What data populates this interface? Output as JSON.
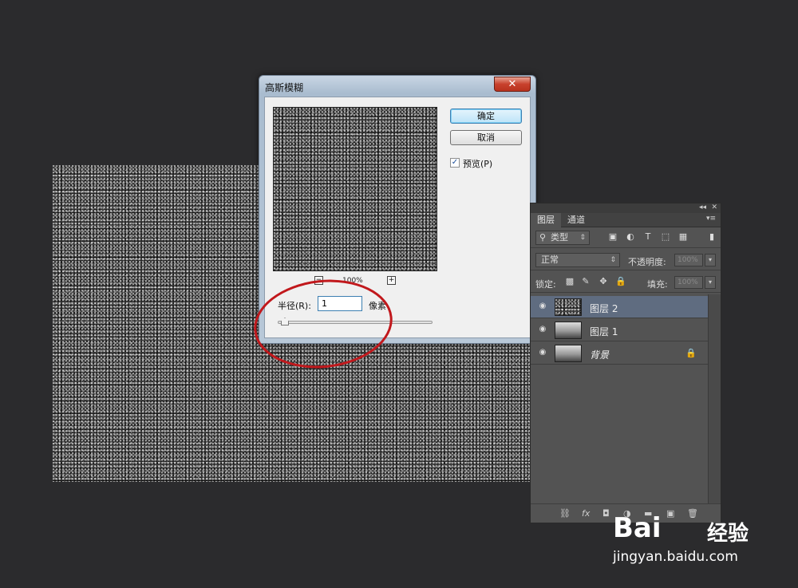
{
  "dialog": {
    "title": "高斯模糊",
    "close_label": "✕",
    "ok_label": "确定",
    "cancel_label": "取消",
    "preview_label": "预览(P)",
    "preview_checked": true,
    "zoom_out_label": "−",
    "zoom_in_label": "+",
    "zoom_level": "100%",
    "radius_label": "半径(R):",
    "radius_value": "1",
    "unit_label": "像素"
  },
  "layers_panel": {
    "tabs": [
      "图层",
      "通道"
    ],
    "filter_label": "类型",
    "blend_mode": "正常",
    "opacity_label": "不透明度:",
    "opacity_value": "100%",
    "lock_label": "锁定:",
    "fill_label": "填充:",
    "fill_value": "100%",
    "layers": [
      {
        "name": "图层 2",
        "selected": true
      },
      {
        "name": "图层 1",
        "selected": false
      },
      {
        "name": "背景",
        "selected": false,
        "locked": true
      }
    ],
    "bottom_icons": [
      "link-icon",
      "fx-icon",
      "mask-icon",
      "adjustment-icon",
      "folder-icon",
      "new-layer-icon",
      "trash-icon"
    ],
    "fx_label": "fx"
  },
  "watermark": {
    "brand": "Bai",
    "brand2": "经验",
    "url": "jingyan.baidu.com"
  },
  "colors": {
    "background": "#2b2b2d",
    "panel": "#535353",
    "selected_layer": "#5f6c80",
    "annotation_red": "#c1181c"
  }
}
